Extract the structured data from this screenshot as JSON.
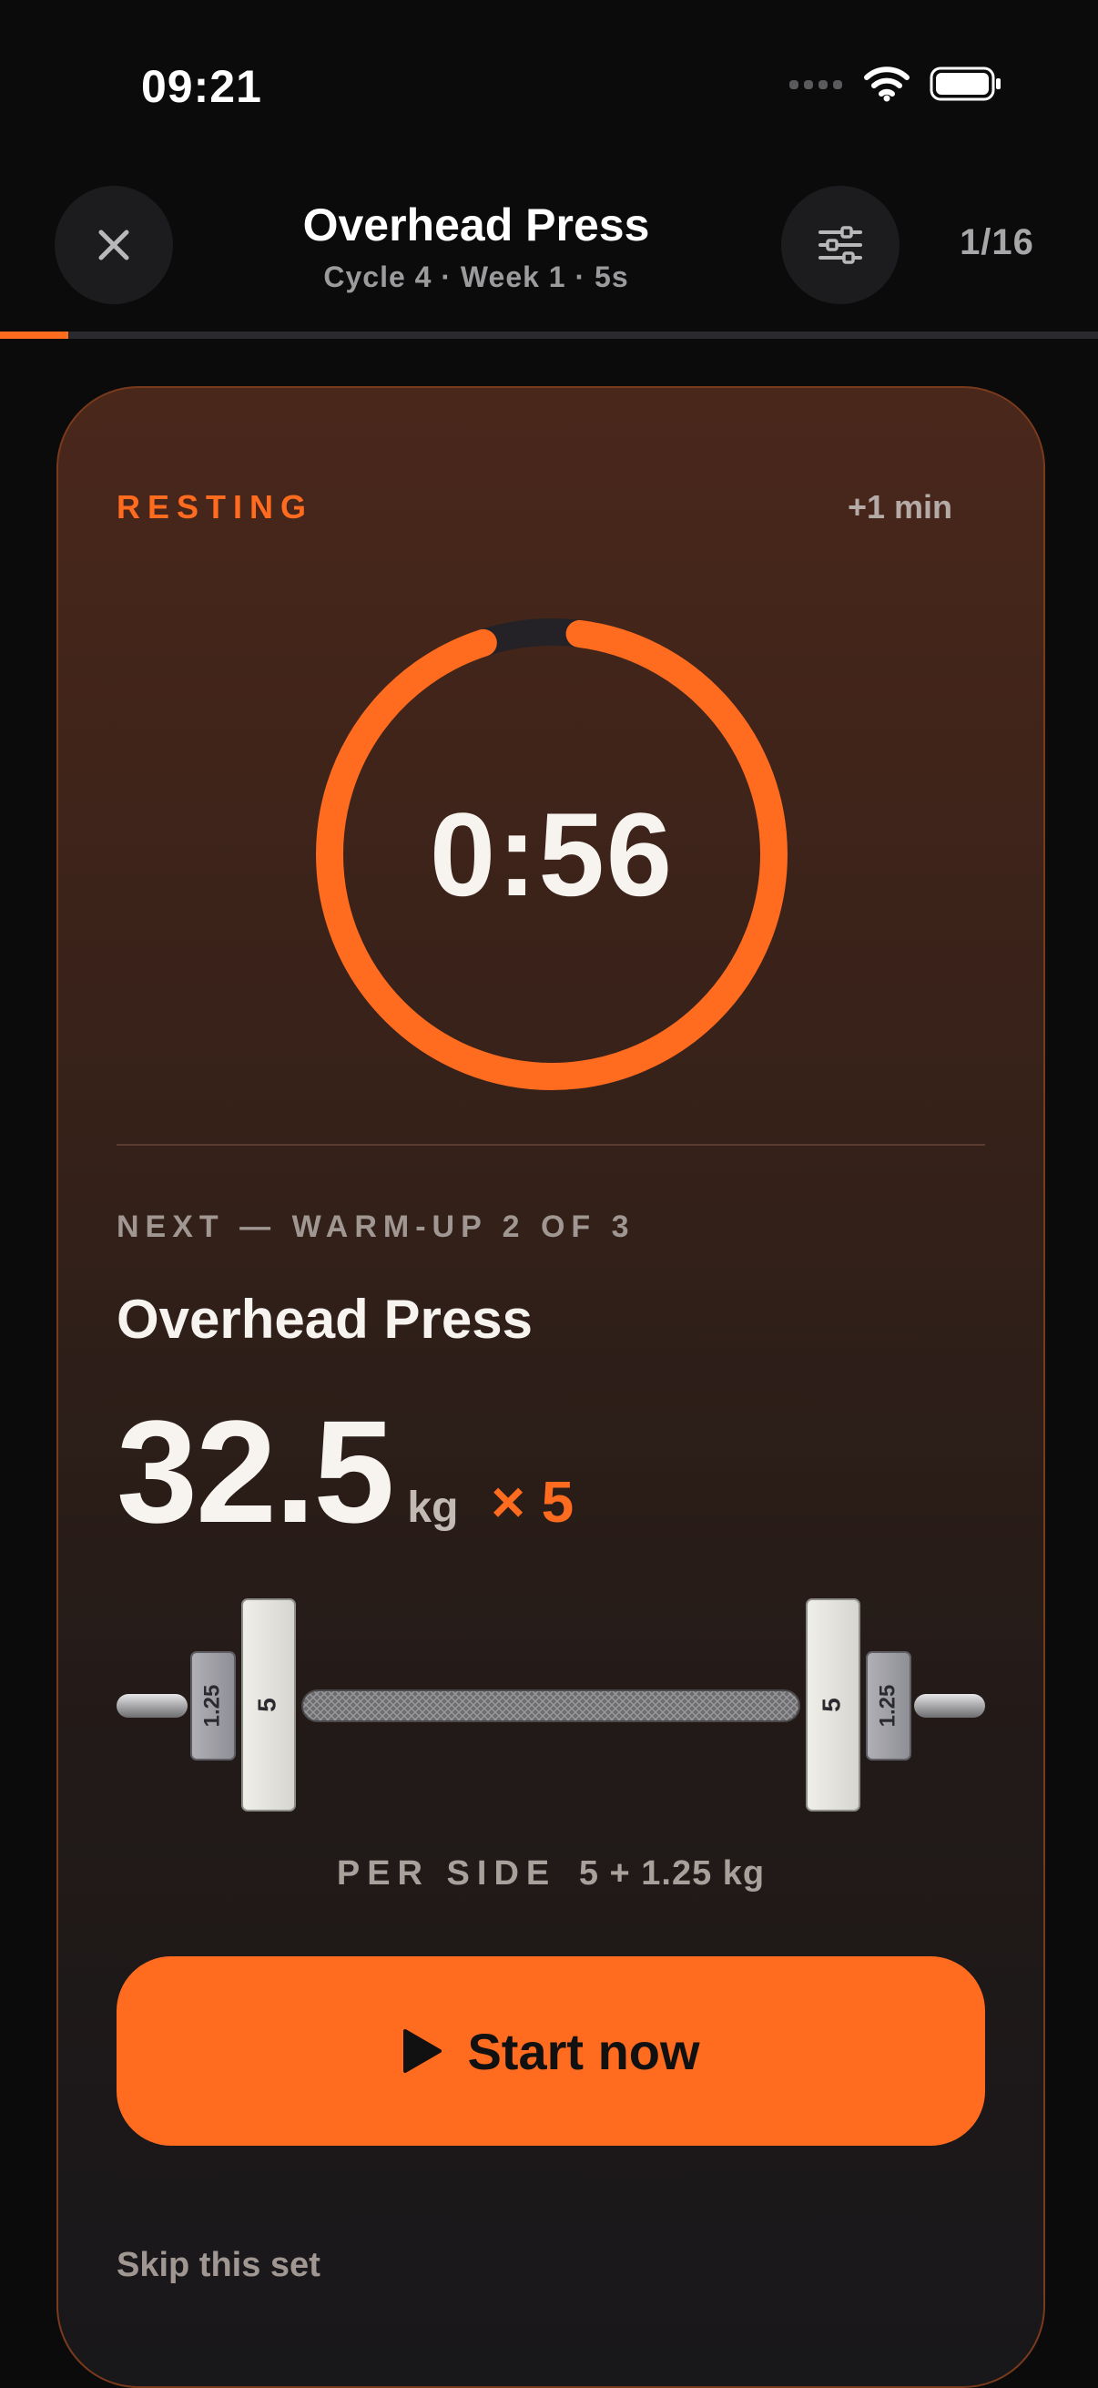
{
  "status_bar": {
    "time": "09:21"
  },
  "header": {
    "title": "Overhead Press",
    "subtitle": "Cycle 4 · Week 1 · 5s",
    "set_counter": "1/16"
  },
  "progress": {
    "fraction": 0.0625,
    "color": "#ff6b1f"
  },
  "rest": {
    "label": "RESTING",
    "add_time_label": "+1 min",
    "timer": "0:56",
    "ring_fraction_remaining": 0.93
  },
  "next_set": {
    "label": "NEXT — WARM-UP 2 OF 3",
    "exercise": "Overhead Press",
    "weight": "32.5",
    "unit": "kg",
    "reps": "× 5"
  },
  "plates": {
    "left": [
      "1.25",
      "5"
    ],
    "right": [
      "5",
      "1.25"
    ],
    "per_side_label": "PER SIDE",
    "per_side_value": "5 + 1.25 kg"
  },
  "actions": {
    "start_label": "Start now",
    "skip_label": "Skip this set"
  },
  "colors": {
    "accent": "#ff6b1f",
    "background": "#0b0b0b"
  }
}
